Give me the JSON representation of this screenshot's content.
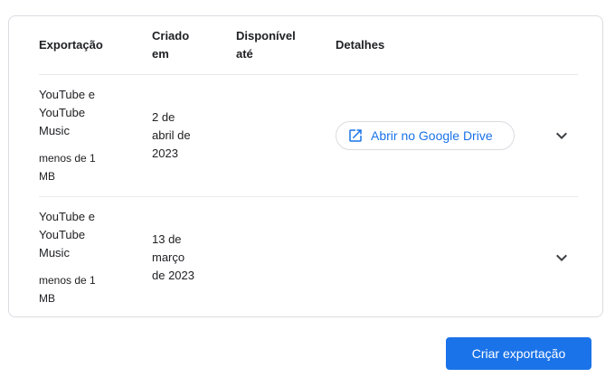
{
  "table": {
    "headers": {
      "exportacao": "Exportação",
      "criado_line1": "Criado",
      "criado_line2": "em",
      "disponivel_line1": "Disponível",
      "disponivel_line2": "até",
      "detalhes": "Detalhes"
    },
    "rows": [
      {
        "name_lines": [
          "YouTube e",
          "YouTube",
          "Music"
        ],
        "size_lines": [
          "menos de 1",
          "MB"
        ],
        "created_lines": [
          "2 de",
          "abril de",
          "2023"
        ],
        "available": "",
        "details_button": "Abrir no Google Drive"
      },
      {
        "name_lines": [
          "YouTube e",
          "YouTube",
          "Music"
        ],
        "size_lines": [
          "menos de 1",
          "MB"
        ],
        "created_lines": [
          "13 de",
          "março",
          "de 2023"
        ],
        "available": ""
      }
    ]
  },
  "create_button": "Criar exportação",
  "icons": {
    "open_external": "open-in-new-icon",
    "expand": "chevron-down-icon"
  },
  "colors": {
    "accent": "#1a73e8",
    "border": "#dadce0",
    "text": "#202124"
  }
}
